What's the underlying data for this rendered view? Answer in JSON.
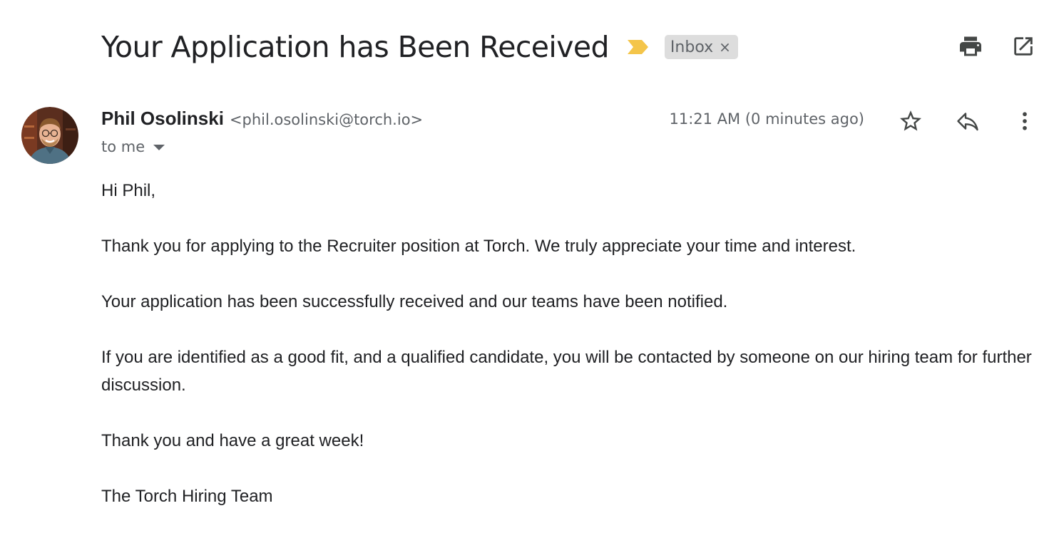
{
  "subject": "Your Application has Been Received",
  "label": {
    "name": "Inbox",
    "remove_symbol": "×"
  },
  "top_actions": {
    "print_icon": "print-icon",
    "open_new_window_icon": "open-in-new-window-icon"
  },
  "sender": {
    "name": "Phil Osolinski",
    "email": "<phil.osolinski@torch.io>"
  },
  "recipient": {
    "text": "to me"
  },
  "timestamp": "11:21 AM (0 minutes ago)",
  "message_actions": {
    "star_icon": "star-icon",
    "reply_icon": "reply-icon",
    "more_icon": "more-vertical-icon"
  },
  "body": {
    "greeting": "Hi Phil,",
    "paragraph_1": "Thank you for applying to the Recruiter position at Torch. We truly appreciate your time and interest.",
    "paragraph_2": "Your application has been successfully received and our teams have been notified.",
    "paragraph_3": "If you are identified as a good fit, and a qualified candidate, you will be contacted by someone on our hiring team for further discussion.",
    "paragraph_4": "Thank you and have a great week!",
    "signature": "The Torch Hiring Team"
  },
  "colors": {
    "importance_marker": "#f4c54a",
    "label_chip_bg": "#dddddd",
    "secondary_text": "#5f6368",
    "primary_text": "#202124"
  }
}
